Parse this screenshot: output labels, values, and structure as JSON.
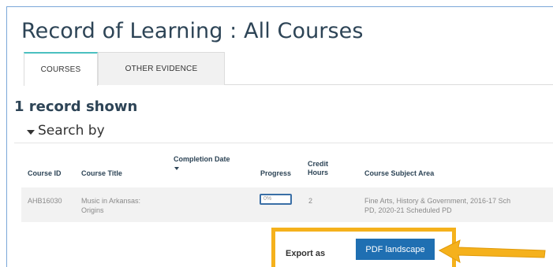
{
  "page": {
    "title": "Record of Learning : All Courses"
  },
  "tabs": [
    {
      "label": "COURSES",
      "active": true
    },
    {
      "label": "OTHER EVIDENCE",
      "active": false
    }
  ],
  "records_shown": "1 record shown",
  "search": {
    "label": "Search by"
  },
  "table": {
    "headers": {
      "course_id": "Course ID",
      "course_title": "Course Title",
      "completion_date": "Completion Date",
      "progress": "Progress",
      "credit_hours_line1": "Credit",
      "credit_hours_line2": "Hours",
      "subject_area": "Course Subject Area"
    },
    "rows": [
      {
        "course_id": "AHB16030",
        "course_title_line1": "Music in Arkansas:",
        "course_title_line2": "Origins",
        "completion_date": "",
        "progress": "0%",
        "credit_hours": "2",
        "subject_area_line1": "Fine Arts, History & Government, 2016-17 Sch",
        "subject_area_line2": "PD, 2020-21 Scheduled PD"
      }
    ]
  },
  "export": {
    "label": "Export as",
    "button_label": "PDF landscape"
  },
  "colors": {
    "highlight": "#f5b11c",
    "button": "#1f6fb2",
    "tab_accent": "#4bc0c0"
  }
}
